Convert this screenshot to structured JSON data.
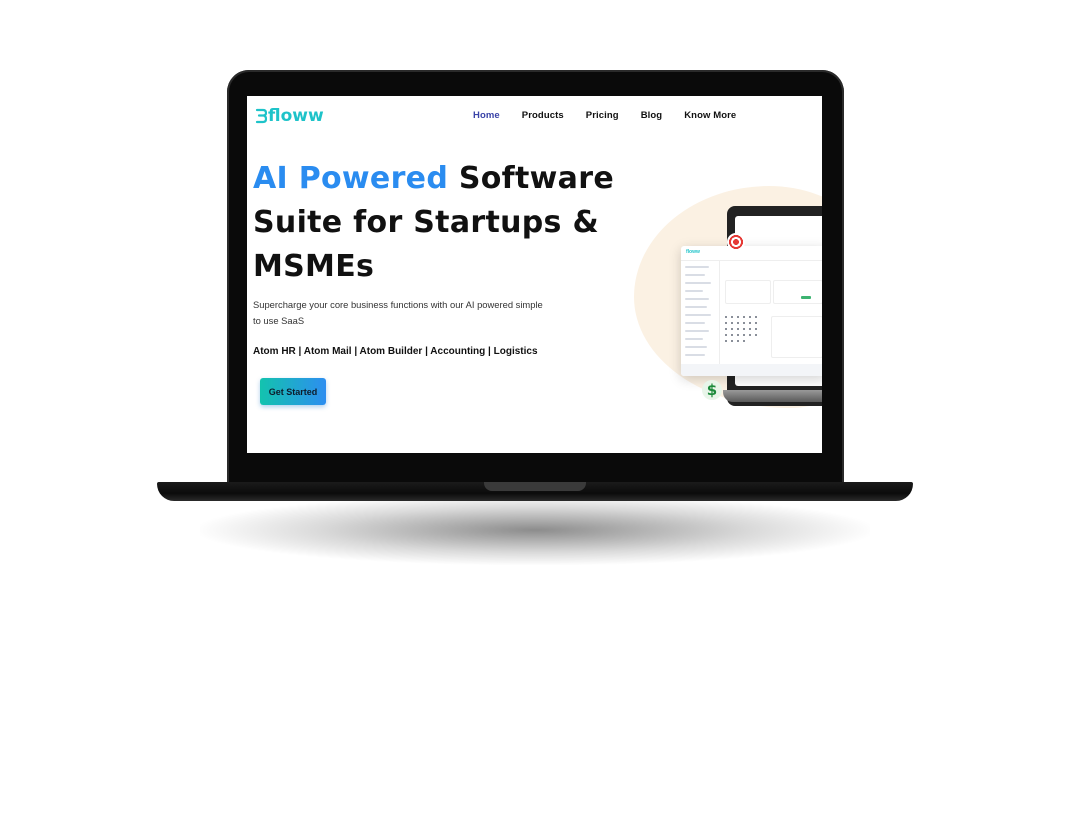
{
  "brand": {
    "logo_text": "floww"
  },
  "nav": {
    "items": [
      {
        "label": "Home",
        "active": true
      },
      {
        "label": "Products",
        "active": false
      },
      {
        "label": "Pricing",
        "active": false
      },
      {
        "label": "Blog",
        "active": false
      },
      {
        "label": "Know More",
        "active": false
      }
    ]
  },
  "hero": {
    "title_accent": "AI Powered",
    "title_rest": " Software Suite for Startups & MSMEs",
    "subtitle": "Supercharge your core business functions with our AI powered simple to use SaaS",
    "products": "Atom HR | Atom Mail | Atom Builder | Accounting | Logistics",
    "cta_label": "Get Started"
  },
  "colors": {
    "brand_teal": "#1ec3c9",
    "accent_blue": "#2a8cf0",
    "nav_active": "#3a43a8",
    "cta_gradient_start": "#13c3ae",
    "cta_gradient_end": "#2d8ef0",
    "illustration_bg": "#fbf1e3"
  },
  "illustration": {
    "icons": [
      "target-icon",
      "dollar-icon"
    ],
    "dollar_symbol": "$"
  }
}
